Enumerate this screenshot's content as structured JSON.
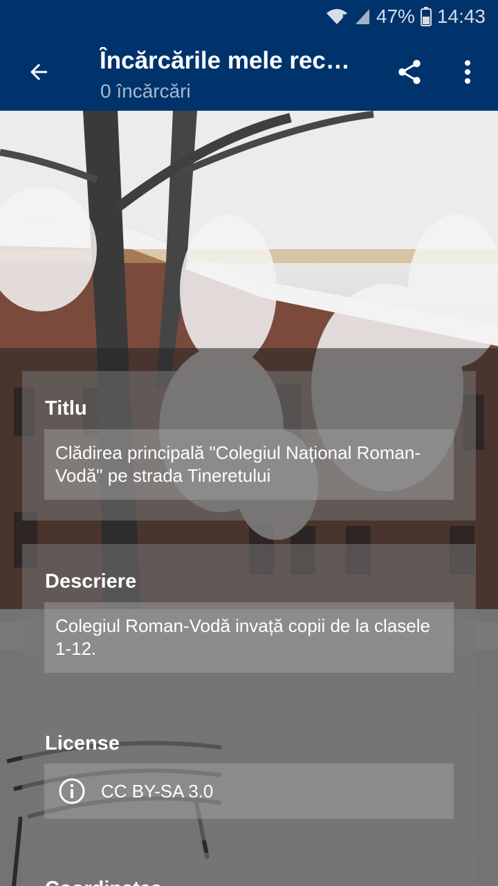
{
  "status_bar": {
    "battery": "47%",
    "time": "14:43"
  },
  "app_bar": {
    "title": "Încărcările mele rec…",
    "subtitle": "0 încărcări",
    "icons": [
      "back-arrow-icon",
      "share-icon",
      "more-vert-icon"
    ]
  },
  "details": {
    "title_label": "Titlu",
    "title_value": "Clădirea principală \"Colegiul Național Roman-Vodă\" pe strada Tineretului",
    "description_label": "Descriere",
    "description_value": "Colegiul Roman-Vodă invață copii de la clasele 1-12.",
    "license_label": "License",
    "license_value": "CC BY-SA 3.0",
    "coordinates_label": "Coordinates"
  },
  "colors": {
    "app_bar": "#00336b",
    "card": "#767676",
    "text": "#ffffff"
  }
}
